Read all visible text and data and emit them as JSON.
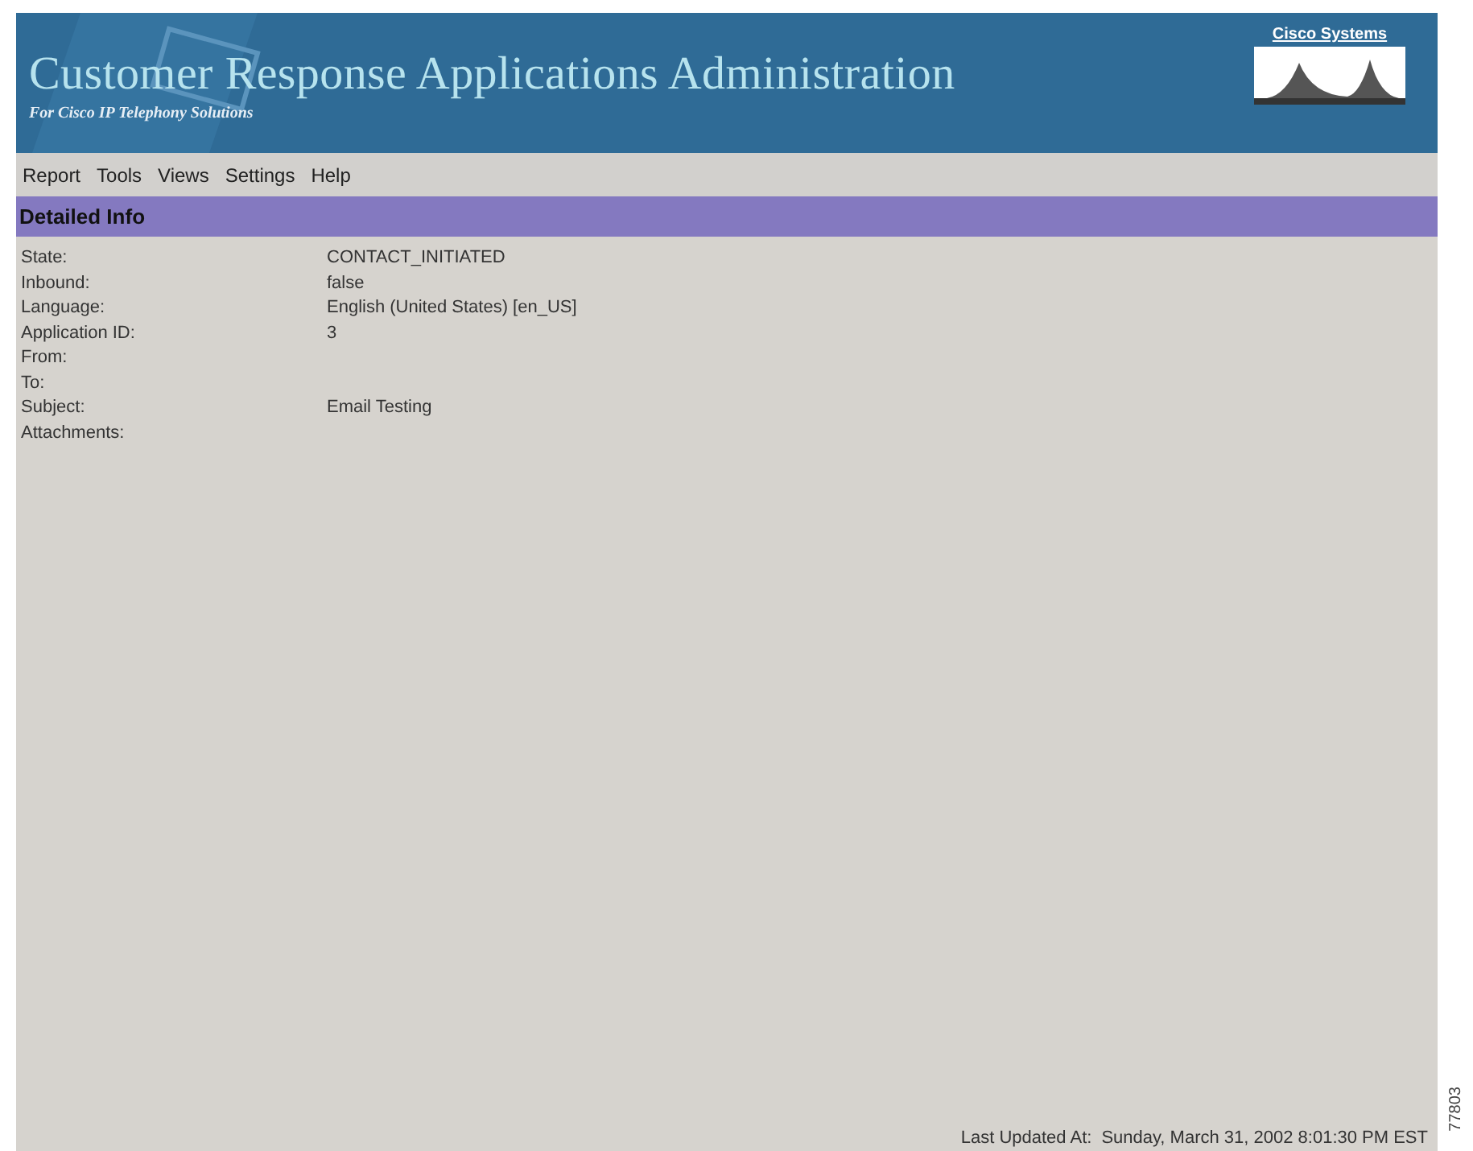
{
  "header": {
    "title": "Customer Response Applications Administration",
    "subtitle": "For Cisco IP Telephony Solutions",
    "logo_text": "Cisco Systems"
  },
  "menu": [
    "Report",
    "Tools",
    "Views",
    "Settings",
    "Help"
  ],
  "section": {
    "title": "Detailed Info"
  },
  "details": [
    {
      "label": "State:",
      "value": "CONTACT_INITIATED"
    },
    {
      "label": "Inbound:",
      "value": "false"
    },
    {
      "label": "Language:",
      "value": "English (United States) [en_US]"
    },
    {
      "label": "Application ID:",
      "value": "3"
    },
    {
      "label": "From:"
    },
    {
      "label": "To:"
    },
    {
      "label": "Subject:",
      "value": "Email Testing"
    },
    {
      "label": "Attachments:"
    }
  ],
  "footer": {
    "label": "Last Updated At:",
    "value": "Sunday, March 31, 2002 8:01:30 PM EST"
  },
  "figure_number": "77803"
}
